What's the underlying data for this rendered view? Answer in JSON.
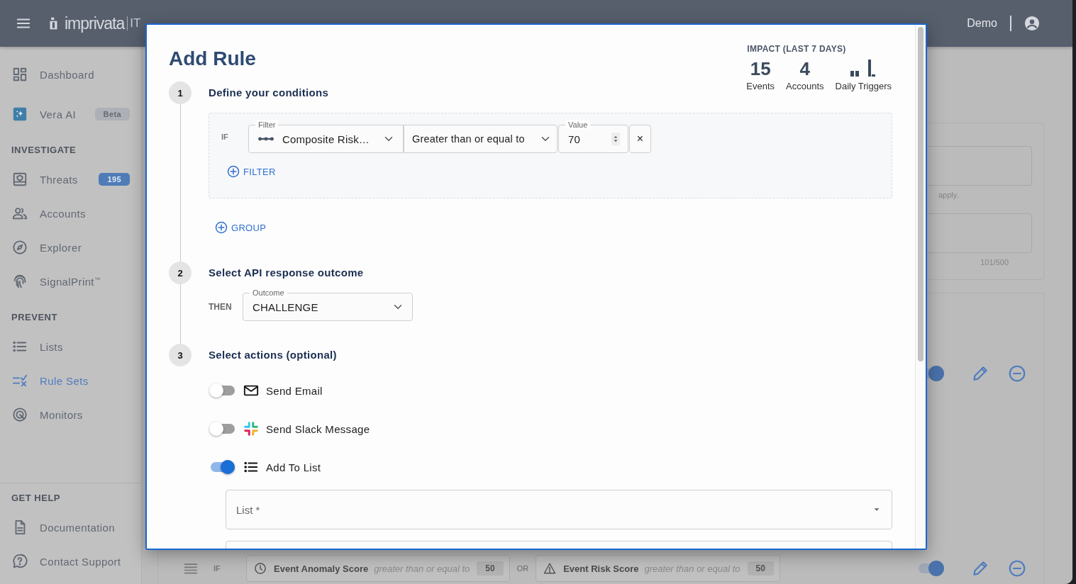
{
  "app_bar": {
    "logo": "imprivata",
    "product": "IT",
    "user": "Demo"
  },
  "sidebar": {
    "groups": [
      {
        "items": [
          {
            "label": "Dashboard",
            "selected": false
          },
          {
            "label": "Vera AI",
            "badge": {
              "text": "Beta",
              "kind": "tag"
            },
            "selected": false
          }
        ]
      },
      {
        "heading": "INVESTIGATE",
        "items": [
          {
            "label": "Threats",
            "badge": {
              "text": "195",
              "kind": "count"
            },
            "selected": false
          },
          {
            "label": "Accounts",
            "selected": false
          },
          {
            "label": "Explorer",
            "selected": false
          },
          {
            "label": "SignalPrint$^{™}$",
            "selected": false
          }
        ]
      },
      {
        "heading": "PREVENT",
        "items": [
          {
            "label": "Lists",
            "selected": false
          },
          {
            "label": "Rule Sets",
            "selected": true
          },
          {
            "label": "Monitors",
            "selected": false
          }
        ]
      }
    ],
    "help": {
      "heading": "GET HELP",
      "items": [
        {
          "label": "Documentation"
        },
        {
          "label": "Contact Support"
        }
      ]
    }
  },
  "background": {
    "settings": {
      "hint": "apply.",
      "counter": "101/500"
    },
    "rules": [
      {
        "enabled": true
      },
      {
        "enabled": true,
        "if_label": "IF",
        "join": "OR",
        "conditions": [
          {
            "field": "Event Anomaly Score",
            "operator": "greater than or equal to",
            "value": "50"
          },
          {
            "field": "Event Risk Score",
            "operator": "greater than or equal to",
            "value": "50"
          }
        ]
      }
    ]
  },
  "modal": {
    "title": "Add Rule",
    "impact": {
      "heading": "IMPACT (LAST 7 DAYS)",
      "stats": [
        {
          "value": "15",
          "label": "Events"
        },
        {
          "value": "4",
          "label": "Accounts"
        }
      ],
      "trigger_label": "Daily Triggers"
    },
    "steps": [
      {
        "number": "1",
        "title": "Define your conditions",
        "kind": "conditions",
        "body": {
          "if_label": "IF",
          "filter": {
            "label": "Filter",
            "value": "Composite Risk…"
          },
          "operator": "Greater than or equal to",
          "value_field": {
            "label": "Value",
            "value": "70"
          },
          "remove": "×",
          "add_filter": "FILTER",
          "add_group": "GROUP"
        }
      },
      {
        "number": "2",
        "title": "Select API response outcome",
        "kind": "outcome",
        "body": {
          "then_label": "THEN",
          "label": "Outcome",
          "value": "CHALLENGE"
        }
      },
      {
        "number": "3",
        "title": "Select actions (optional)",
        "kind": "actions",
        "body": {
          "actions": [
            {
              "label": "Send Email",
              "on": false
            },
            {
              "label": "Send Slack Message",
              "on": false
            },
            {
              "label": "Add To List",
              "on": true
            }
          ],
          "list_field": {
            "placeholder": "List *"
          }
        }
      }
    ]
  }
}
